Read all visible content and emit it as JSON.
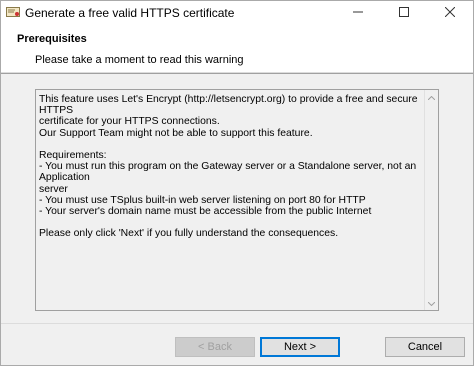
{
  "window": {
    "title": "Generate a free valid HTTPS certificate",
    "icons": {
      "app": "certificate-app-icon",
      "minimize": "minimize-icon",
      "maximize": "maximize-icon",
      "close": "close-icon"
    }
  },
  "header": {
    "title": "Prerequisites",
    "subtitle": "Please take a moment to read this warning"
  },
  "warning_text": "This feature uses Let's Encrypt (http://letsencrypt.org) to provide a free and secure HTTPS\ncertificate for your HTTPS connections.\nOur Support Team might not be able to support this feature.\n\nRequirements:\n- You must run this program on the Gateway server or a Standalone server, not an Application\nserver\n- You must use TSplus built-in web server listening on port 80 for HTTP\n- Your server's domain name must be accessible from the public Internet\n\nPlease only click 'Next' if you fully understand the consequences.",
  "buttons": {
    "back": "< Back",
    "next": "Next >",
    "cancel": "Cancel"
  },
  "colors": {
    "accent": "#0078d7",
    "dialog_bg": "#f0f0f0"
  }
}
